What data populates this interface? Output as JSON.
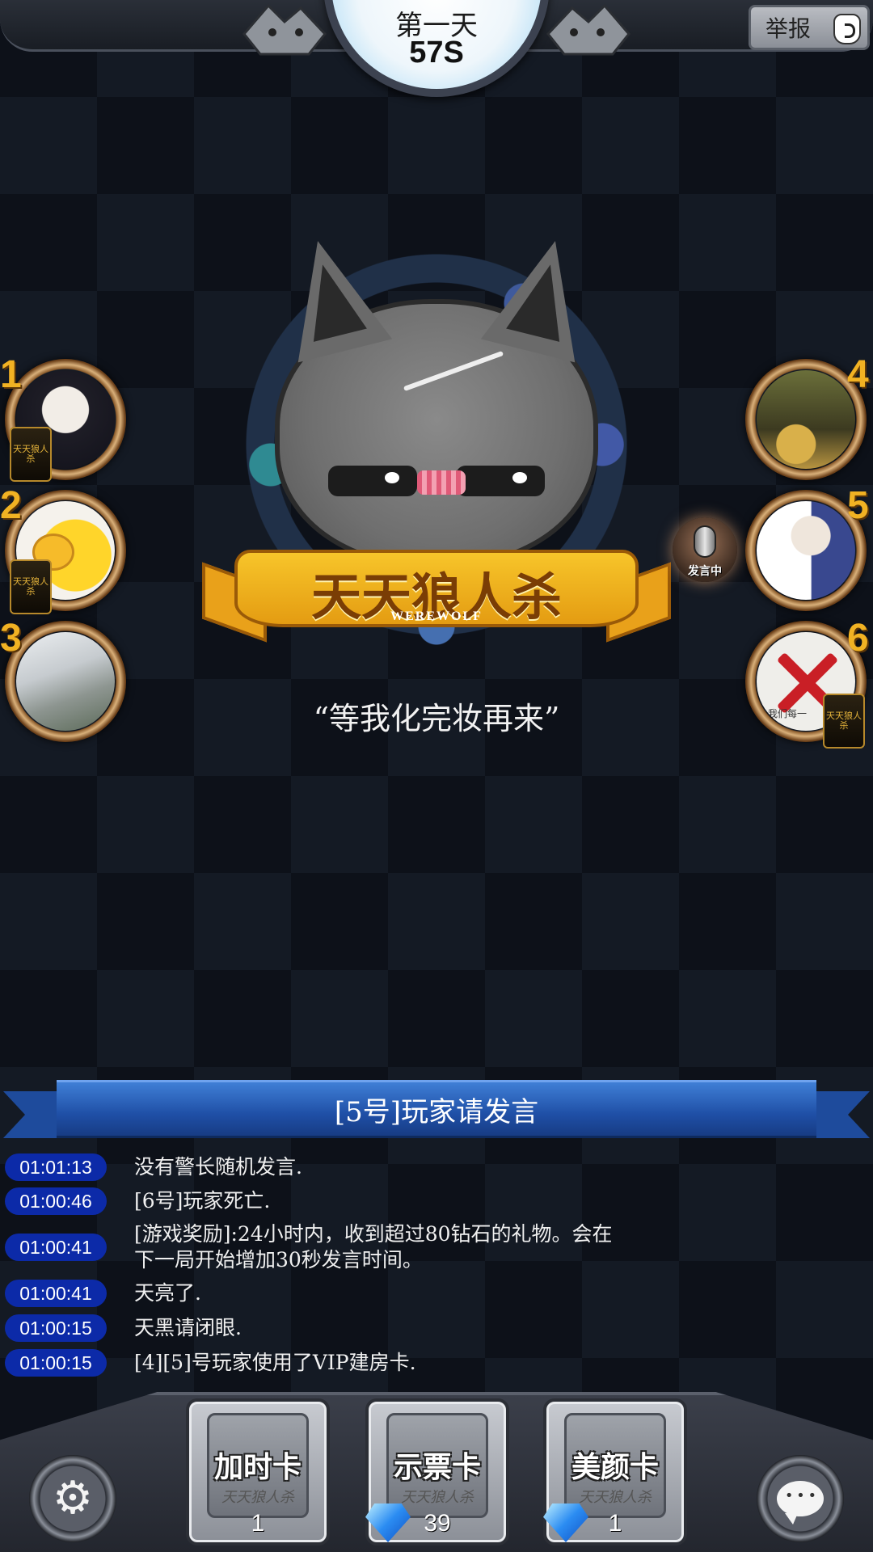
{
  "header": {
    "day": "第一天",
    "timer": "57S",
    "report_label": "举报"
  },
  "emblem": {
    "logo_text": "天天狼人杀",
    "logo_sub": "WEREWOLF"
  },
  "quote": "“等我化完妆再来”",
  "players": [
    {
      "num": "1",
      "card": true
    },
    {
      "num": "2",
      "card": true
    },
    {
      "num": "3",
      "card": false
    },
    {
      "num": "4",
      "card": false
    },
    {
      "num": "5",
      "card": false,
      "speaking": true
    },
    {
      "num": "6",
      "card": true,
      "banned_text": "我们每一"
    }
  ],
  "card_badge_text": "天天狼人杀",
  "speaking_label": "发言中",
  "banner": "[5号]玩家请发言",
  "log": [
    {
      "time": "01:01:13",
      "msg": "没有警长随机发言."
    },
    {
      "time": "01:00:46",
      "msg": "[6号]玩家死亡."
    },
    {
      "time": "01:00:41",
      "msg": "[游戏奖励]:24小时内，收到超过80钻石的礼物。会在\n下一局开始增加30秒发言时间。"
    },
    {
      "time": "01:00:41",
      "msg": "天亮了."
    },
    {
      "time": "01:00:15",
      "msg": "天黑请闭眼."
    },
    {
      "time": "01:00:15",
      "msg": "[4][5]号玩家使用了VIP建房卡."
    }
  ],
  "cards": [
    {
      "title": "加时卡",
      "sub": "天天狼人杀",
      "count": "1",
      "gem": false
    },
    {
      "title": "示票卡",
      "sub": "天天狼人杀",
      "count": "39",
      "gem": true
    },
    {
      "title": "美颜卡",
      "sub": "天天狼人杀",
      "count": "1",
      "gem": true
    }
  ],
  "icons": {
    "settings": "gear-icon",
    "chat": "chat-bubble-icon",
    "report": "hand-icon",
    "speaking": "microphone-icon",
    "gem": "diamond-icon"
  },
  "colors": {
    "seat_number": "#f1b223",
    "banner": "#1f4fa6",
    "log_time_bg": "#0c2aa8"
  }
}
